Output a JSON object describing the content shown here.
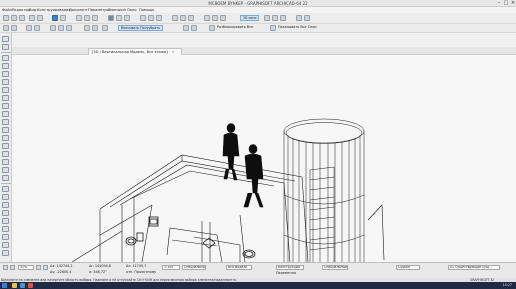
{
  "window": {
    "title": "MCBOEM BYHKEP - GRAPHISOFT ARCHICAD-64 22"
  },
  "menu": [
    "Файл",
    "Редактор",
    "Вид",
    "Конструирование",
    "Документ",
    "Параметры",
    "Teamwork",
    "Окно",
    "Помощь"
  ],
  "toolbar": {
    "scale_chip": "3D окно",
    "selection_label": "Вписывать Полуубрать",
    "section_label_1": "Разблокировать Все",
    "section_label_2": "Показывать Все Слои"
  },
  "tab": {
    "label": "[3D / Вертикальная Модель, Все этажи]"
  },
  "infobox": {
    "angle_x": "747 ",
    "scale_text": "1:100",
    "zoom_text": "31%",
    "coord_dx": "Δx: 142744,1",
    "coord_dy": "Δy: -22600,4",
    "coord_r": "Δr: 144094,8",
    "coord_a": "a: 346,72°",
    "coord_z": "Δz: 11745,7",
    "coord_ref": "отн. Проектному",
    "pen_mode": "Специальный",
    "structure": "Вся модель",
    "layer_mode": "Конструкция",
    "view_name": "Специальный",
    "renovation": "Custom",
    "status_right": "01 Существующие сущ...",
    "mode_label": "Переменно"
  },
  "status": {
    "hint": "Щелкните на элементе или начертите область выбора. Нажмите и не отпускайте Ctrl+Shift для переключения выбора элемента/подэлемента.",
    "brand": "GRAPHISOFT ID"
  },
  "taskbar": {
    "clock": "14:27"
  }
}
